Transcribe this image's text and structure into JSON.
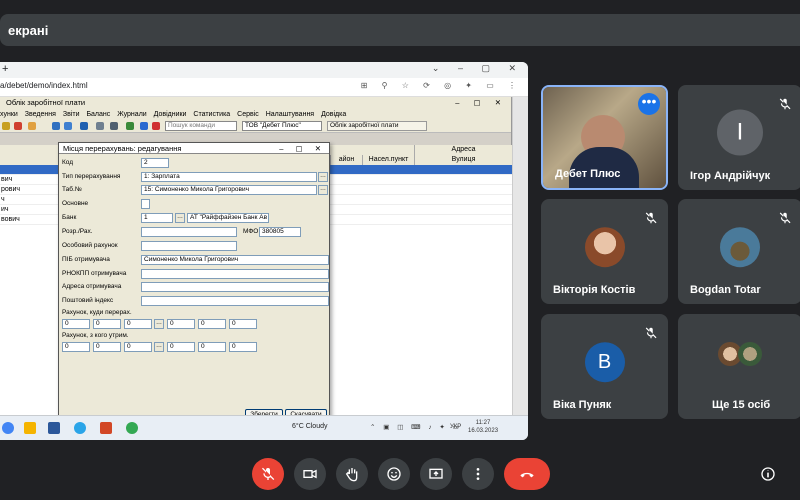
{
  "meeting": {
    "title": "екрані"
  },
  "browser": {
    "address": "a/debet/demo/index.html",
    "tab_plus": "+"
  },
  "app": {
    "window_title": "Облік заробітної плати",
    "menu": [
      "хунки",
      "Зведення",
      "Звіти",
      "Баланс",
      "Журнали",
      "Довідники",
      "Статистика",
      "Сервіс",
      "Налаштування",
      "Довідка"
    ],
    "search_placeholder": "Пошук команди",
    "org_select": "ТОВ \"Дебет Плюс\"",
    "module_tab": "Облік заробітної плати",
    "columns": {
      "raion": "айон",
      "settlement": "Насел.пункт",
      "address": "Адреса",
      "street": "Вулиця"
    },
    "rows": [
      "вич",
      "рович",
      "ч",
      "ич",
      "вович"
    ]
  },
  "dialog": {
    "title": "Місця перерахувань: редагування",
    "fields": {
      "code_label": "Код",
      "code_value": "2",
      "type_label": "Тип перерахування",
      "type_value": "1: Зарплата",
      "tab_label": "Таб.№",
      "tab_value": "15: Симоненко Микола Григорович",
      "main_label": "Основне",
      "bank_label": "Банк",
      "bank_num": "1",
      "bank_name": "АТ \"Райффайзен Банк Ав",
      "account_label": "Розр./Рах.",
      "mfo_label": "МФО",
      "mfo_value": "380805",
      "special_label": "Особовий рахунок",
      "recipient_label": "ПІБ отримувача",
      "recipient_value": "Симоненко Микола Григорович",
      "rnokpp_label": "РНОКПП отримувача",
      "address_label": "Адреса отримувача",
      "zip_label": "Поштовий індекс",
      "acc_to_label": "Рахунок, куди перерах.",
      "acc_from_label": "Рахунок, з кого утрим.",
      "acc_zero": "0"
    },
    "save": "Зберегти",
    "cancel": "Скасувати"
  },
  "taskbar": {
    "weather": "6°C  Cloudy",
    "lang": "УКР",
    "time": "11:27",
    "date": "16.03.2023"
  },
  "participants": [
    {
      "name": "Дебет Плюс",
      "initial": ""
    },
    {
      "name": "Ігор Андрійчук",
      "initial": "І"
    },
    {
      "name": "Вікторія Костів",
      "initial": ""
    },
    {
      "name": "Bogdan Totar",
      "initial": ""
    },
    {
      "name": "Віка Пуняк",
      "initial": "В"
    },
    {
      "name": "Ще 15 осіб",
      "initial": ""
    }
  ],
  "colors": {
    "bg": "#202124",
    "tile": "#3c4043",
    "accent": "#8ab4f8",
    "end_call": "#ea4335",
    "mic_off": "#ea4335",
    "avatar_igor": "#5f6368",
    "avatar_vika": "#1a5da8",
    "selection": "#316ac5"
  },
  "icons": [
    "mic-off-icon",
    "camera-icon",
    "hand-icon",
    "emoji-icon",
    "present-icon",
    "more-icon",
    "end-call-icon",
    "info-icon"
  ]
}
